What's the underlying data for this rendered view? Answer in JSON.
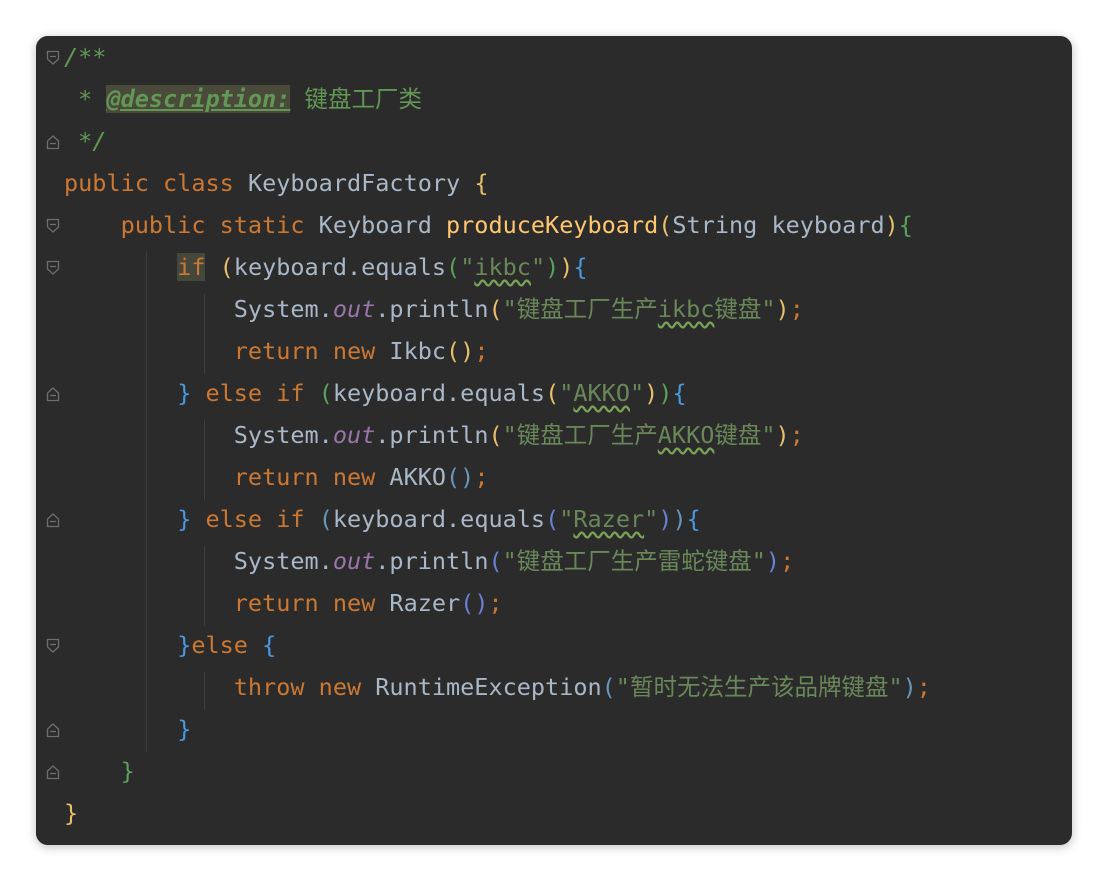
{
  "editor": {
    "lines": [
      {
        "tokens": [
          {
            "t": "/**",
            "c": "comment"
          }
        ]
      },
      {
        "tokens": [
          {
            "t": " * ",
            "c": "comment"
          },
          {
            "t": "@description:",
            "c": "tag"
          },
          {
            "t": " 键盘工厂类",
            "c": "comment-text"
          }
        ]
      },
      {
        "tokens": [
          {
            "t": " */",
            "c": "comment"
          }
        ]
      },
      {
        "tokens": [
          {
            "t": "public class ",
            "c": "kw"
          },
          {
            "t": "KeyboardFactory ",
            "c": "plain"
          },
          {
            "t": "{",
            "c": "brace1"
          }
        ]
      },
      {
        "tokens": [
          {
            "t": "    public static ",
            "c": "kw"
          },
          {
            "t": "Keyboard ",
            "c": "plain"
          },
          {
            "t": "produceKeyboard",
            "c": "fn"
          },
          {
            "t": "(",
            "c": "p1"
          },
          {
            "t": "String keyboard",
            "c": "plain"
          },
          {
            "t": ")",
            "c": "p1"
          },
          {
            "t": "{",
            "c": "brace2"
          }
        ]
      },
      {
        "tokens": [
          {
            "t": "        ",
            "c": "plain"
          },
          {
            "t": "if",
            "c": "kw if-hl"
          },
          {
            "t": " ",
            "c": "plain"
          },
          {
            "t": "(",
            "c": "p1"
          },
          {
            "t": "keyboard.equals",
            "c": "plain"
          },
          {
            "t": "(",
            "c": "p3"
          },
          {
            "t": "\"",
            "c": "str"
          },
          {
            "t": "ikbc",
            "c": "str squiggle"
          },
          {
            "t": "\"",
            "c": "str"
          },
          {
            "t": ")",
            "c": "p3"
          },
          {
            "t": ")",
            "c": "p1"
          },
          {
            "t": "{",
            "c": "brace3"
          }
        ]
      },
      {
        "tokens": [
          {
            "t": "            System.",
            "c": "plain"
          },
          {
            "t": "out",
            "c": "static-field"
          },
          {
            "t": ".println",
            "c": "plain"
          },
          {
            "t": "(",
            "c": "p1"
          },
          {
            "t": "\"键盘工厂生产",
            "c": "str"
          },
          {
            "t": "ikbc",
            "c": "str squiggle"
          },
          {
            "t": "键盘\"",
            "c": "str"
          },
          {
            "t": ")",
            "c": "p1"
          },
          {
            "t": ";",
            "c": "kw"
          }
        ]
      },
      {
        "tokens": [
          {
            "t": "            return new ",
            "c": "kw"
          },
          {
            "t": "Ikbc",
            "c": "plain"
          },
          {
            "t": "(",
            "c": "p1"
          },
          {
            "t": ")",
            "c": "p1"
          },
          {
            "t": ";",
            "c": "kw"
          }
        ]
      },
      {
        "tokens": [
          {
            "t": "        ",
            "c": "plain"
          },
          {
            "t": "}",
            "c": "brace3"
          },
          {
            "t": " else if ",
            "c": "kw"
          },
          {
            "t": "(",
            "c": "p3"
          },
          {
            "t": "keyboard.equals",
            "c": "plain"
          },
          {
            "t": "(",
            "c": "p1"
          },
          {
            "t": "\"",
            "c": "str"
          },
          {
            "t": "AKKO",
            "c": "str squiggle"
          },
          {
            "t": "\"",
            "c": "str"
          },
          {
            "t": ")",
            "c": "p1"
          },
          {
            "t": ")",
            "c": "p3"
          },
          {
            "t": "{",
            "c": "brace3"
          }
        ]
      },
      {
        "tokens": [
          {
            "t": "            System.",
            "c": "plain"
          },
          {
            "t": "out",
            "c": "static-field"
          },
          {
            "t": ".println",
            "c": "plain"
          },
          {
            "t": "(",
            "c": "p1"
          },
          {
            "t": "\"键盘工厂生产",
            "c": "str"
          },
          {
            "t": "AKKO",
            "c": "str squiggle"
          },
          {
            "t": "键盘\"",
            "c": "str"
          },
          {
            "t": ")",
            "c": "p1"
          },
          {
            "t": ";",
            "c": "kw"
          }
        ]
      },
      {
        "tokens": [
          {
            "t": "            return new ",
            "c": "kw"
          },
          {
            "t": "AKKO",
            "c": "plain"
          },
          {
            "t": "(",
            "c": "p2"
          },
          {
            "t": ")",
            "c": "p2"
          },
          {
            "t": ";",
            "c": "kw"
          }
        ]
      },
      {
        "tokens": [
          {
            "t": "        ",
            "c": "plain"
          },
          {
            "t": "}",
            "c": "brace3"
          },
          {
            "t": " else if ",
            "c": "kw"
          },
          {
            "t": "(",
            "c": "p2"
          },
          {
            "t": "keyboard.equals",
            "c": "plain"
          },
          {
            "t": "(",
            "c": "p4"
          },
          {
            "t": "\"",
            "c": "str"
          },
          {
            "t": "Razer",
            "c": "str squiggle"
          },
          {
            "t": "\"",
            "c": "str"
          },
          {
            "t": ")",
            "c": "p4"
          },
          {
            "t": ")",
            "c": "p2"
          },
          {
            "t": "{",
            "c": "brace3"
          }
        ]
      },
      {
        "tokens": [
          {
            "t": "            System.",
            "c": "plain"
          },
          {
            "t": "out",
            "c": "static-field"
          },
          {
            "t": ".println",
            "c": "plain"
          },
          {
            "t": "(",
            "c": "p4"
          },
          {
            "t": "\"键盘工厂生产雷蛇键盘\"",
            "c": "str"
          },
          {
            "t": ")",
            "c": "p4"
          },
          {
            "t": ";",
            "c": "kw"
          }
        ]
      },
      {
        "tokens": [
          {
            "t": "            return new ",
            "c": "kw"
          },
          {
            "t": "Razer",
            "c": "plain"
          },
          {
            "t": "(",
            "c": "p4"
          },
          {
            "t": ")",
            "c": "p4"
          },
          {
            "t": ";",
            "c": "kw"
          }
        ]
      },
      {
        "tokens": [
          {
            "t": "        ",
            "c": "plain"
          },
          {
            "t": "}",
            "c": "brace3"
          },
          {
            "t": "else ",
            "c": "kw"
          },
          {
            "t": "{",
            "c": "brace3"
          }
        ]
      },
      {
        "tokens": [
          {
            "t": "            throw new ",
            "c": "kw"
          },
          {
            "t": "RuntimeException",
            "c": "plain"
          },
          {
            "t": "(",
            "c": "p2"
          },
          {
            "t": "\"暂时无法生产该品牌键盘\"",
            "c": "str"
          },
          {
            "t": ")",
            "c": "p2"
          },
          {
            "t": ";",
            "c": "kw"
          }
        ]
      },
      {
        "tokens": [
          {
            "t": "        ",
            "c": "plain"
          },
          {
            "t": "}",
            "c": "brace3"
          }
        ]
      },
      {
        "tokens": [
          {
            "t": "    ",
            "c": "plain"
          },
          {
            "t": "}",
            "c": "brace2"
          }
        ]
      },
      {
        "tokens": [
          {
            "t": "}",
            "c": "brace1"
          }
        ]
      }
    ],
    "fold_markers": [
      {
        "line": 0,
        "icon": "fold-open-icon"
      },
      {
        "line": 2,
        "icon": "fold-close-icon"
      },
      {
        "line": 4,
        "icon": "fold-open-icon"
      },
      {
        "line": 5,
        "icon": "fold-open-icon"
      },
      {
        "line": 8,
        "icon": "fold-close-icon"
      },
      {
        "line": 11,
        "icon": "fold-close-icon"
      },
      {
        "line": 14,
        "icon": "fold-open-icon"
      },
      {
        "line": 16,
        "icon": "fold-close-icon"
      },
      {
        "line": 17,
        "icon": "fold-close-icon"
      }
    ],
    "colors": {
      "background": "#2b2b2b",
      "keyword": "#cc7832",
      "string": "#6a8759",
      "comment": "#629755",
      "method": "#ffc66d",
      "static_field": "#9876aa",
      "plain": "#a9b7c6"
    }
  }
}
